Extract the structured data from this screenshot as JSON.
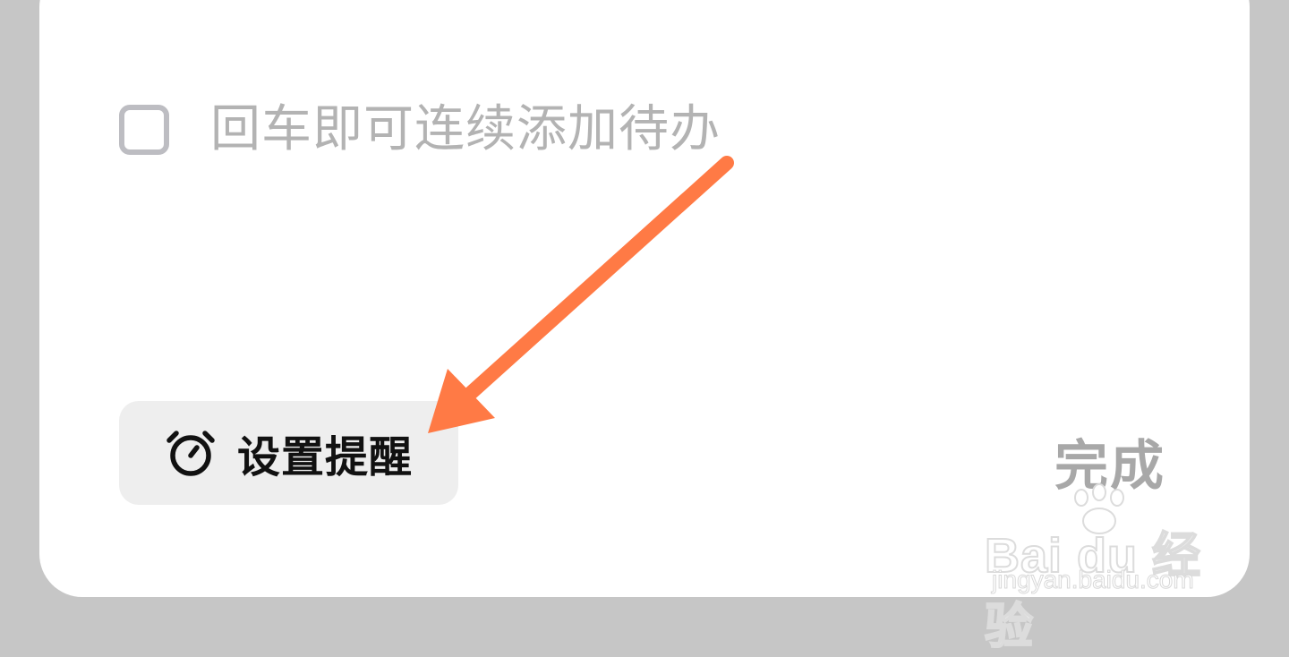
{
  "task": {
    "placeholder": "回车即可连续添加待办",
    "value": ""
  },
  "toolbar": {
    "reminder_label": "设置提醒",
    "reminder_icon": "alarm-clock-icon",
    "done_label": "完成"
  },
  "annotation": {
    "arrow_color": "#ff7a45"
  },
  "watermark": {
    "brand": "Bai du 经验",
    "url": "jingyan.baidu.com"
  },
  "colors": {
    "background": "#c6c6c6",
    "card": "#ffffff",
    "placeholder_text": "#b3b3b3",
    "done_text": "#a8a8a8",
    "reminder_bg": "#eeeeee"
  }
}
